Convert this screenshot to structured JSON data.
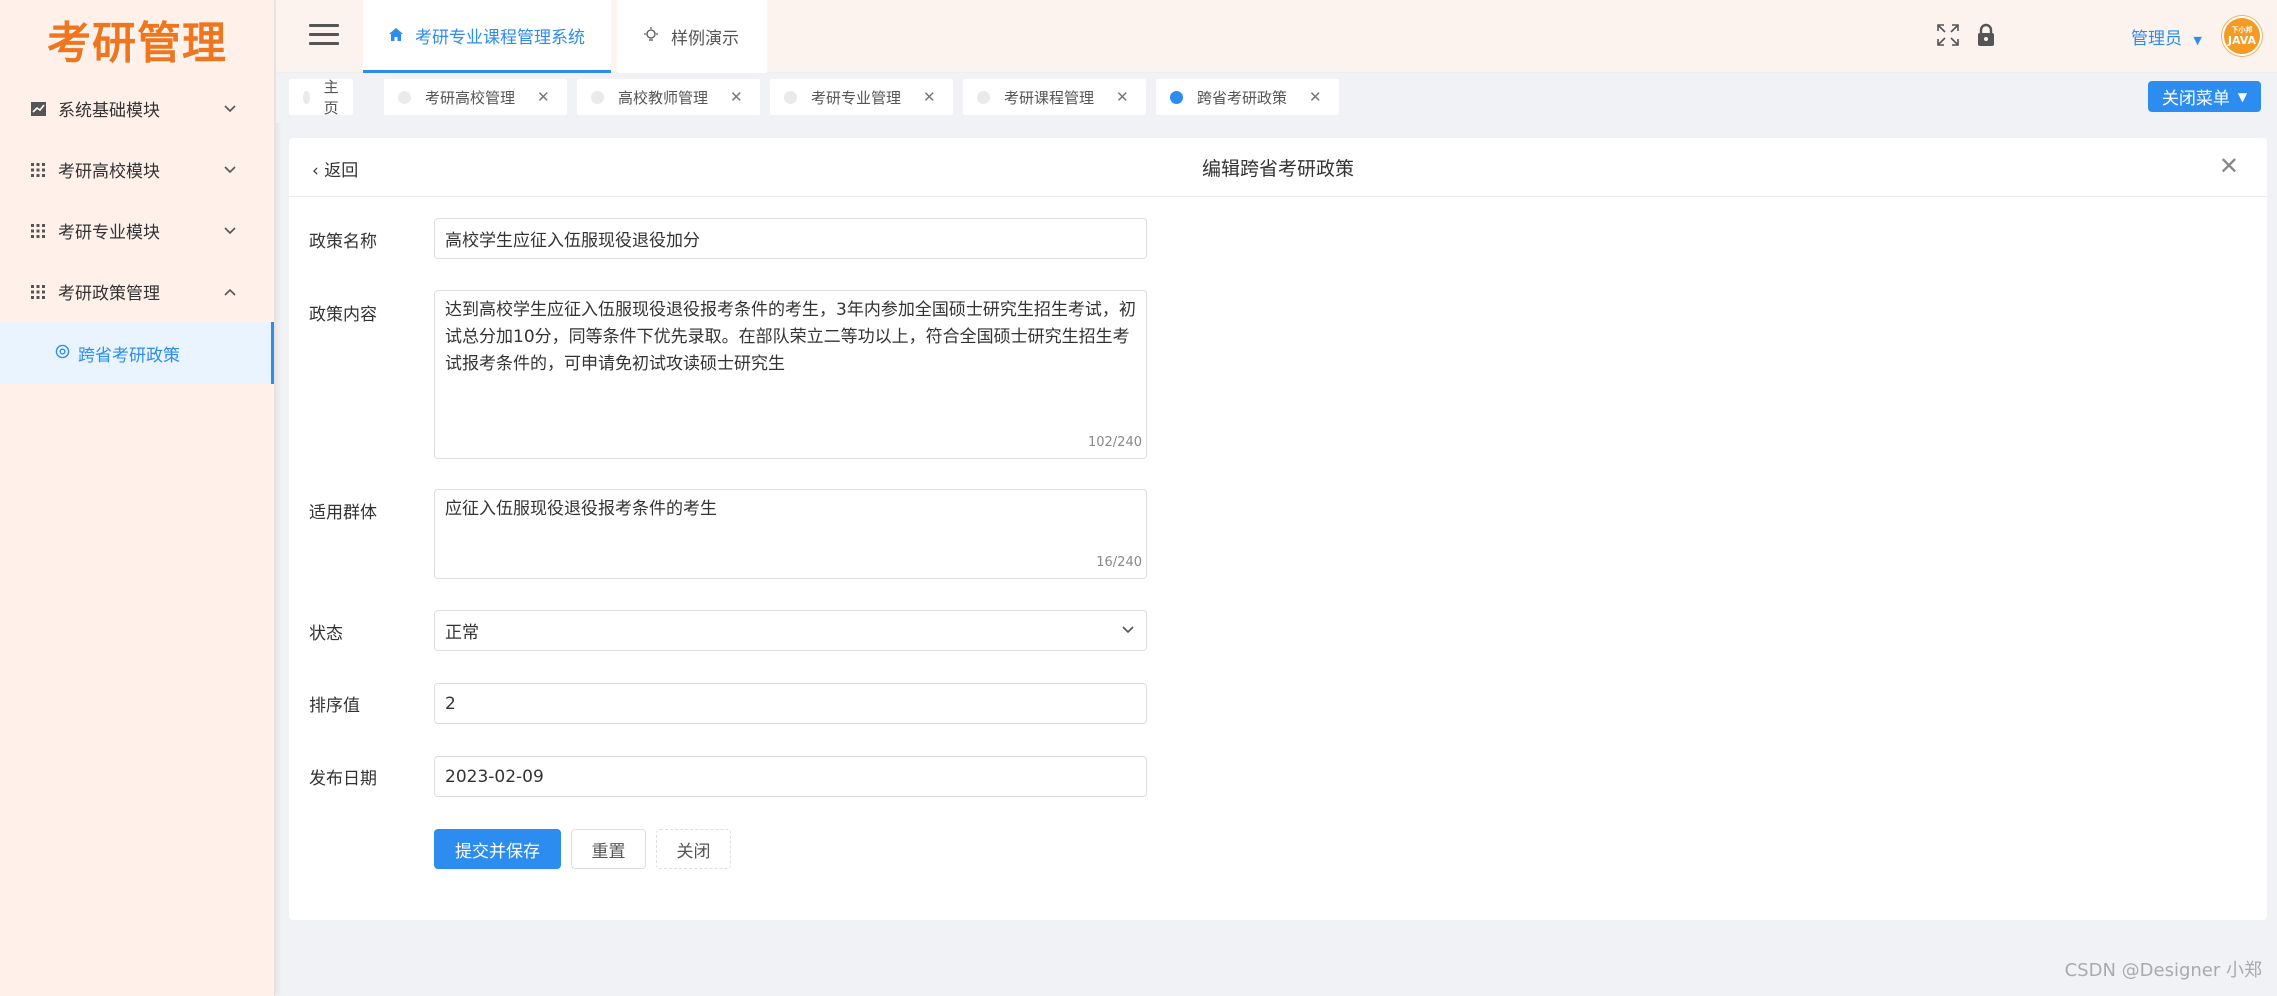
{
  "brand": {
    "logo_text": "考研管理",
    "accent": "#2d8cf0",
    "logo_color": "#f0751f"
  },
  "sidebar": {
    "items": [
      {
        "label": "系统基础模块",
        "icon": "chart-icon",
        "arrow": "chevron-down"
      },
      {
        "label": "考研高校模块",
        "icon": "grid-icon",
        "arrow": "chevron-down"
      },
      {
        "label": "考研专业模块",
        "icon": "grid-icon",
        "arrow": "chevron-down"
      },
      {
        "label": "考研政策管理",
        "icon": "grid-icon",
        "arrow": "chevron-up"
      }
    ],
    "sub_item": {
      "label": "跨省考研政策",
      "icon": "gear-circle-icon"
    }
  },
  "topbar": {
    "tabs": [
      {
        "label": "考研专业课程管理系统",
        "icon": "home-icon"
      },
      {
        "label": "样例演示",
        "icon": "bulb-icon"
      }
    ],
    "user": {
      "name": "管理员",
      "avatar_text_top": "下小邦",
      "avatar_text": "JAVA"
    }
  },
  "tags": [
    {
      "label": "主页",
      "closable": false,
      "active": false
    },
    {
      "label": "考研高校管理",
      "closable": true,
      "active": false
    },
    {
      "label": "高校教师管理",
      "closable": true,
      "active": false
    },
    {
      "label": "考研专业管理",
      "closable": true,
      "active": false
    },
    {
      "label": "考研课程管理",
      "closable": true,
      "active": false
    },
    {
      "label": "跨省考研政策",
      "closable": true,
      "active": true
    }
  ],
  "close_menu_label": "关闭菜单",
  "card": {
    "back_label": "返回",
    "title": "编辑跨省考研政策",
    "fields": {
      "name": {
        "label": "政策名称",
        "value": "高校学生应征入伍服现役退役加分"
      },
      "content": {
        "label": "政策内容",
        "value": "达到高校学生应征入伍服现役退役报考条件的考生，3年内参加全国硕士研究生招生考试，初试总分加10分，同等条件下优先录取。在部队荣立二等功以上，符合全国硕士研究生招生考试报考条件的，可申请免初试攻读硕士研究生",
        "counter": "102/240"
      },
      "group": {
        "label": "适用群体",
        "value": "应征入伍服现役退役报考条件的考生",
        "counter": "16/240"
      },
      "status": {
        "label": "状态",
        "value": "正常"
      },
      "sort": {
        "label": "排序值",
        "value": "2"
      },
      "date": {
        "label": "发布日期",
        "value": "2023-02-09"
      }
    },
    "buttons": {
      "submit": "提交并保存",
      "reset": "重置",
      "close": "关闭"
    }
  },
  "watermark": "CSDN @Designer 小郑"
}
